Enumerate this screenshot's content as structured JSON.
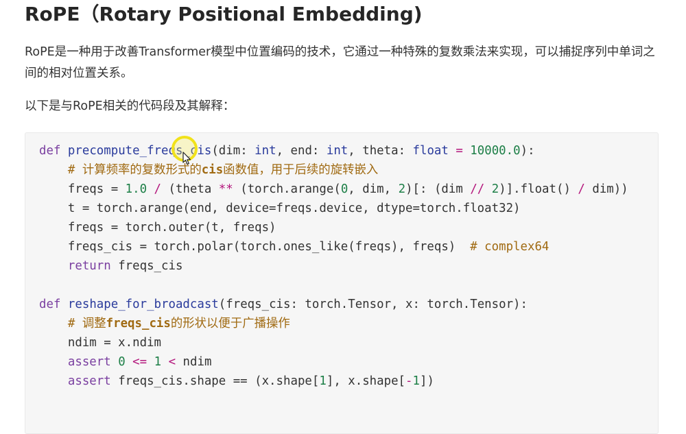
{
  "title": "RoPE（Rotary Positional Embedding)",
  "para1": "RoPE是一种用于改善Transformer模型中位置编码的技术，它通过一种特殊的复数乘法来实现，可以捕捉序列中单词之间的相对位置关系。",
  "para2": "以下是与RoPE相关的代码段及其解释：",
  "code": {
    "l1": {
      "kw": "def",
      "fn": "precompute_freqs_cis",
      "a": "(dim: ",
      "t1": "int",
      "b": ", end: ",
      "t2": "int",
      "c": ", theta: ",
      "t3": "float",
      "op": " = ",
      "n": "10000.0",
      "d": "):"
    },
    "l2": {
      "hash": "# 计算频率的复数形式的",
      "bold": "cis",
      "rest": "函数值，用于后续的旋转嵌入"
    },
    "l3": {
      "a": "freqs = ",
      "n1": "1.0",
      "op1": " / ",
      "b": "(theta ",
      "op2": "**",
      "c": " (torch.arange(",
      "n2": "0",
      "d": ", dim, ",
      "n3": "2",
      "e": ")[: (dim ",
      "op3": "//",
      "f": " ",
      "n4": "2",
      "g": ")].float() ",
      "op4": "/",
      "h": " dim))"
    },
    "l4": "t = torch.arange(end, device=freqs.device, dtype=torch.float32)",
    "l5": "freqs = torch.outer(t, freqs)",
    "l6": {
      "a": "freqs_cis = torch.polar(torch.ones_like(freqs), freqs)  ",
      "cm": "# complex64"
    },
    "l7": {
      "kw": "return",
      "a": " freqs_cis"
    },
    "l8": {
      "kw": "def",
      "fn": "reshape_for_broadcast",
      "a": "(freqs_cis: torch.Tensor, x: torch.Tensor):"
    },
    "l9": {
      "hash": "# 调整",
      "bold": "freqs_cis",
      "rest": "的形状以便于广播操作"
    },
    "l10": "ndim = x.ndim",
    "l11": {
      "kw": "assert",
      "n1": "0",
      "op1": "<=",
      "n2": "1",
      "op2": "<",
      "a": "ndim"
    },
    "l12": {
      "kw": "assert",
      "a": " freqs_cis.shape == (x.shape[",
      "n1": "1",
      "b": "], x.shape[",
      "op": "-",
      "n2": "1",
      "c": "])"
    }
  },
  "colors": {
    "keyword": "#7a3fa0",
    "function": "#2a3b9c",
    "number": "#1d7f47",
    "operator": "#b4187d",
    "comment": "#a06a12",
    "cursor_highlight": "#f1e21b"
  },
  "icons": {
    "cursor": "mouse-pointer-icon"
  }
}
